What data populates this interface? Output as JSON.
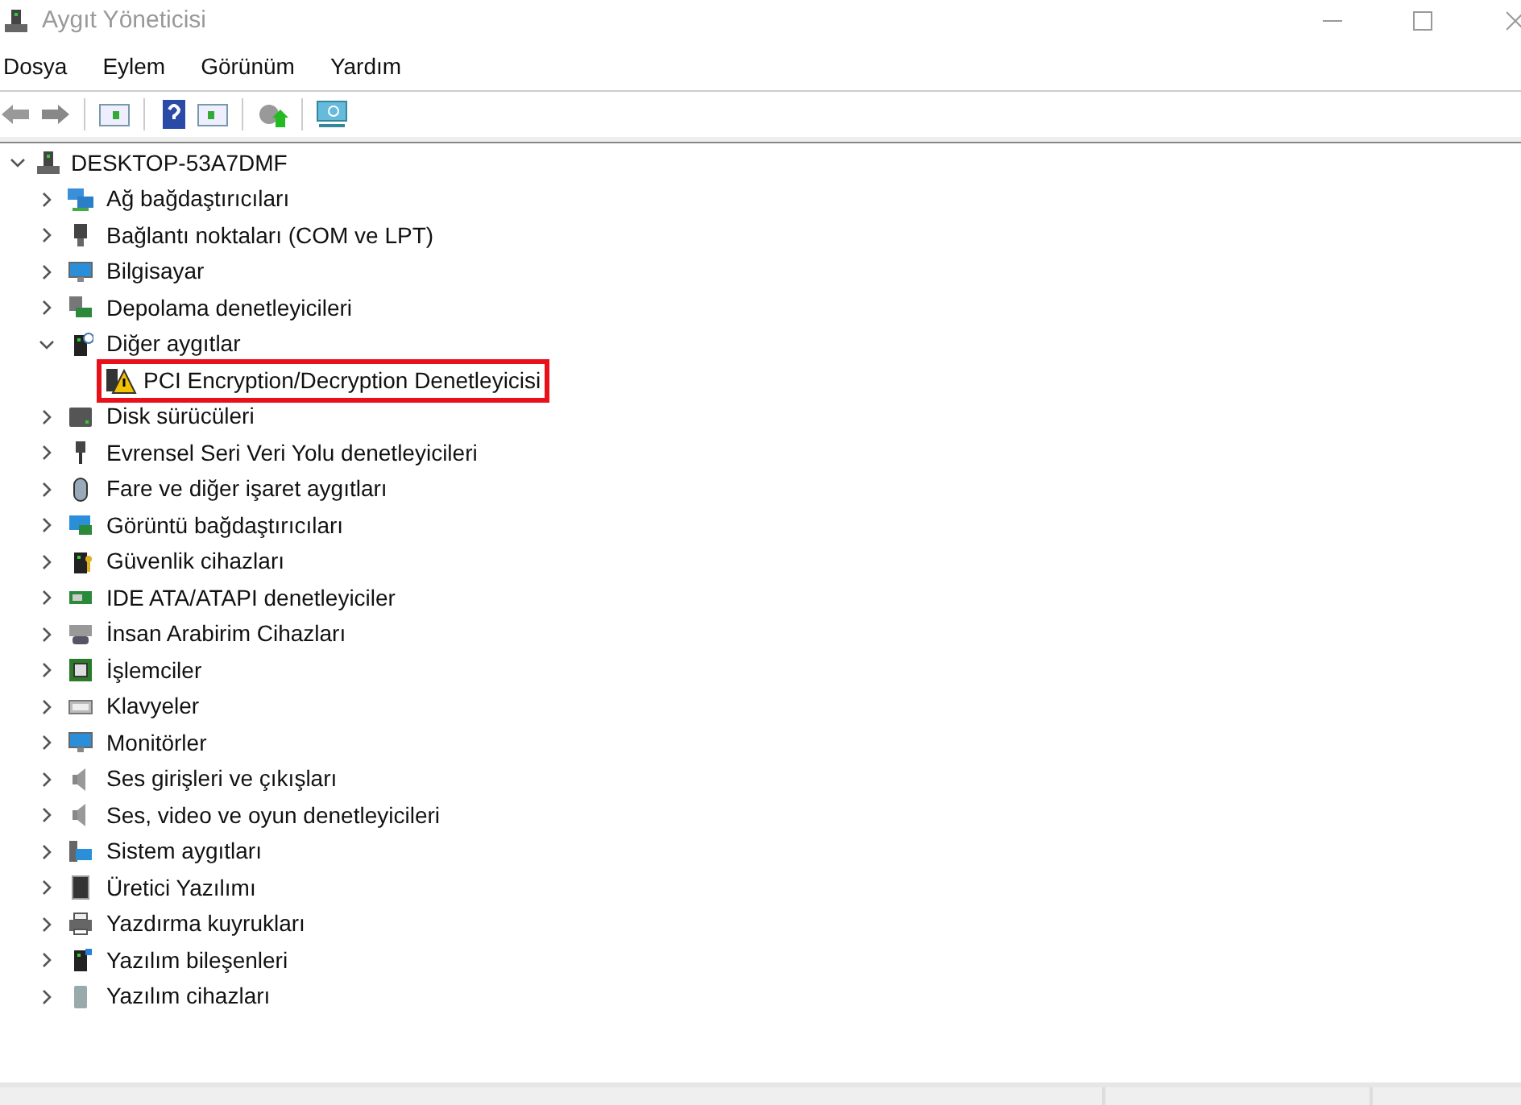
{
  "window": {
    "title": "Aygıt Yöneticisi"
  },
  "menu": [
    "Dosya",
    "Eylem",
    "Görünüm",
    "Yardım"
  ],
  "tree": {
    "label": "DESKTOP-53A7DMF",
    "expanded": true,
    "children": [
      {
        "label": "Ağ bağdaştırıcıları",
        "expanded": false
      },
      {
        "label": "Bağlantı noktaları (COM ve LPT)",
        "expanded": false
      },
      {
        "label": "Bilgisayar",
        "expanded": false
      },
      {
        "label": "Depolama denetleyicileri",
        "expanded": false
      },
      {
        "label": "Diğer aygıtlar",
        "expanded": true,
        "children": [
          {
            "label": "PCI Encryption/Decryption Denetleyicisi",
            "highlighted": true
          }
        ]
      },
      {
        "label": "Disk sürücüleri",
        "expanded": false
      },
      {
        "label": "Evrensel Seri Veri Yolu denetleyicileri",
        "expanded": false
      },
      {
        "label": "Fare ve diğer işaret aygıtları",
        "expanded": false
      },
      {
        "label": "Görüntü bağdaştırıcıları",
        "expanded": false
      },
      {
        "label": "Güvenlik cihazları",
        "expanded": false
      },
      {
        "label": "IDE ATA/ATAPI denetleyiciler",
        "expanded": false
      },
      {
        "label": "İnsan Arabirim Cihazları",
        "expanded": false
      },
      {
        "label": "İşlemciler",
        "expanded": false
      },
      {
        "label": "Klavyeler",
        "expanded": false
      },
      {
        "label": "Monitörler",
        "expanded": false
      },
      {
        "label": "Ses girişleri ve çıkışları",
        "expanded": false
      },
      {
        "label": "Ses, video ve oyun denetleyicileri",
        "expanded": false
      },
      {
        "label": "Sistem aygıtları",
        "expanded": false
      },
      {
        "label": "Üretici Yazılımı",
        "expanded": false
      },
      {
        "label": "Yazdırma kuyrukları",
        "expanded": false
      },
      {
        "label": "Yazılım bileşenleri",
        "expanded": false
      },
      {
        "label": "Yazılım cihazları",
        "expanded": false
      }
    ]
  }
}
